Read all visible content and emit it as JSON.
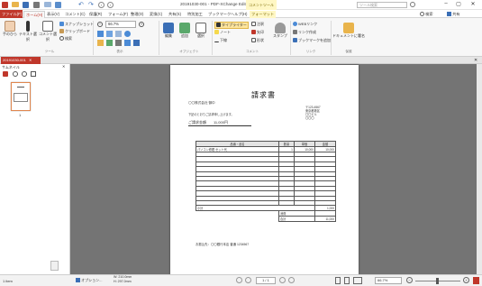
{
  "window": {
    "title": "20191030-001 - PDF-XChange Editor",
    "context_label": "コメントツール",
    "search_placeholder": "ツール検索",
    "find_label": "検索",
    "share_label": "共有"
  },
  "tabs": [
    {
      "label": "ファイル(F)"
    },
    {
      "label": "ホーム(H)"
    },
    {
      "label": "表示(V)"
    },
    {
      "label": "コメント(C)"
    },
    {
      "label": "保護(R)"
    },
    {
      "label": "フォーム(F)"
    },
    {
      "label": "整理(O)"
    },
    {
      "label": "変換(C)"
    },
    {
      "label": "共有(S)"
    },
    {
      "label": "特別加工"
    },
    {
      "label": "ブックマーク"
    },
    {
      "label": "ヘルプ(H)"
    },
    {
      "label": "フォーマット"
    }
  ],
  "ribbon": {
    "hand_tool": "手のひら",
    "select_text": "テキスト選択",
    "select_comment": "コメント選択",
    "snapshot": "スナップショット",
    "clipboard": "クリップボード",
    "find": "検索",
    "zoom_value": "66.7%",
    "group_tools": "ツール",
    "group_view": "表示",
    "edit": "編集",
    "add": "追加",
    "select": "選択",
    "group_objects": "オブジェクト",
    "typewriter": "タイプライター",
    "textbox": "注釈",
    "note": "ノート",
    "highlight": "注意",
    "arrow": "矢印",
    "line": "下線",
    "stamp": "スタンプ",
    "shape": "形状",
    "group_comment": "コメント",
    "web_link": "WEBリンク",
    "link_create": "リンク作成",
    "add_bookmark": "ブックマークを追加",
    "group_link": "リンク",
    "sign_doc": "ドキュメントに署名",
    "group_protect": "保護"
  },
  "doc_tab": "20191030-001",
  "thumbnails": {
    "title": "サムネイル",
    "page_number": "1"
  },
  "invoice": {
    "heading": "請求書",
    "to": "〇〇株式会社 御中",
    "from_lines": [
      "〒123-4567",
      "東京都港区",
      "〇〇ビル",
      "〇〇〇"
    ],
    "intro": "下記のとおりご請求申し上げます。",
    "total_label": "ご請求金額",
    "total_value": "11,000円",
    "columns": [
      "品番・品名",
      "数量",
      "単価",
      "金額"
    ],
    "rows": [
      {
        "name": "パソコン修理 セット代",
        "qty": "1",
        "price": "10,000",
        "amount": "10,000"
      }
    ],
    "subtotal_label": "小計",
    "subtotal_value": "1,000",
    "tax_label": "消費",
    "sum_label": "合計",
    "sum_value": "11,000",
    "bank_line": "お振込先：〇〇銀行本店 普通 1234567"
  },
  "status": {
    "left": "1 item",
    "options": "オプション...",
    "width": "W: 210.0mm",
    "height": "H: 297.0mm",
    "page_display": "1 / 1",
    "zoom": "66.7%"
  }
}
